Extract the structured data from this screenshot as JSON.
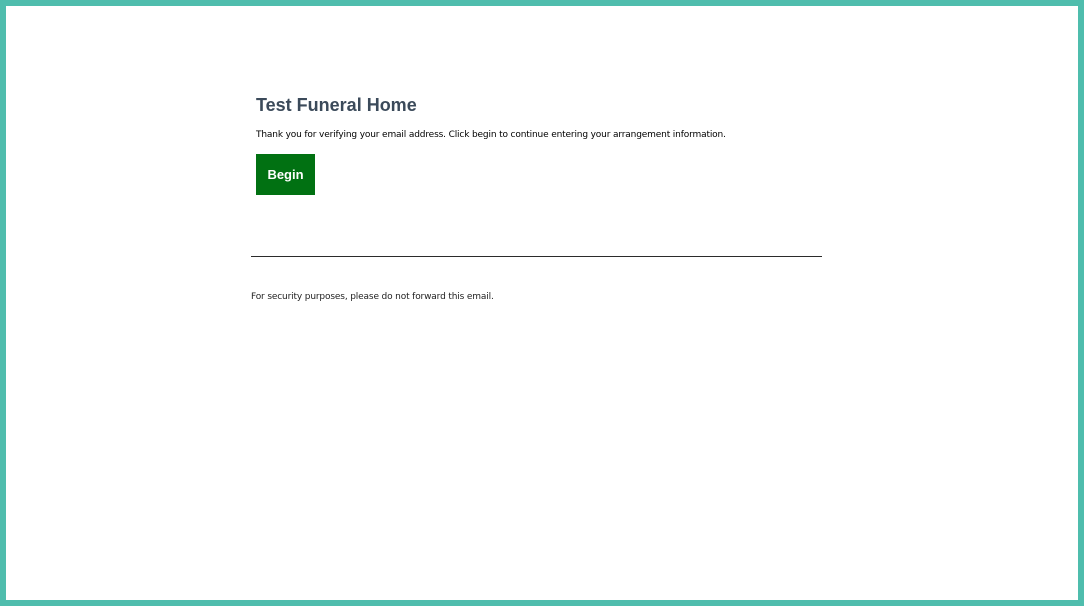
{
  "email": {
    "title": "Test Funeral Home",
    "message": "Thank you for verifying your email address. Click begin to continue entering your arrangement information.",
    "begin_label": "Begin",
    "security_note": "For security purposes, please do not forward this email."
  },
  "colors": {
    "frame_border": "#4fbdad",
    "title_text": "#3b4a5a",
    "button_background": "#017112",
    "button_text": "#ffffff"
  }
}
